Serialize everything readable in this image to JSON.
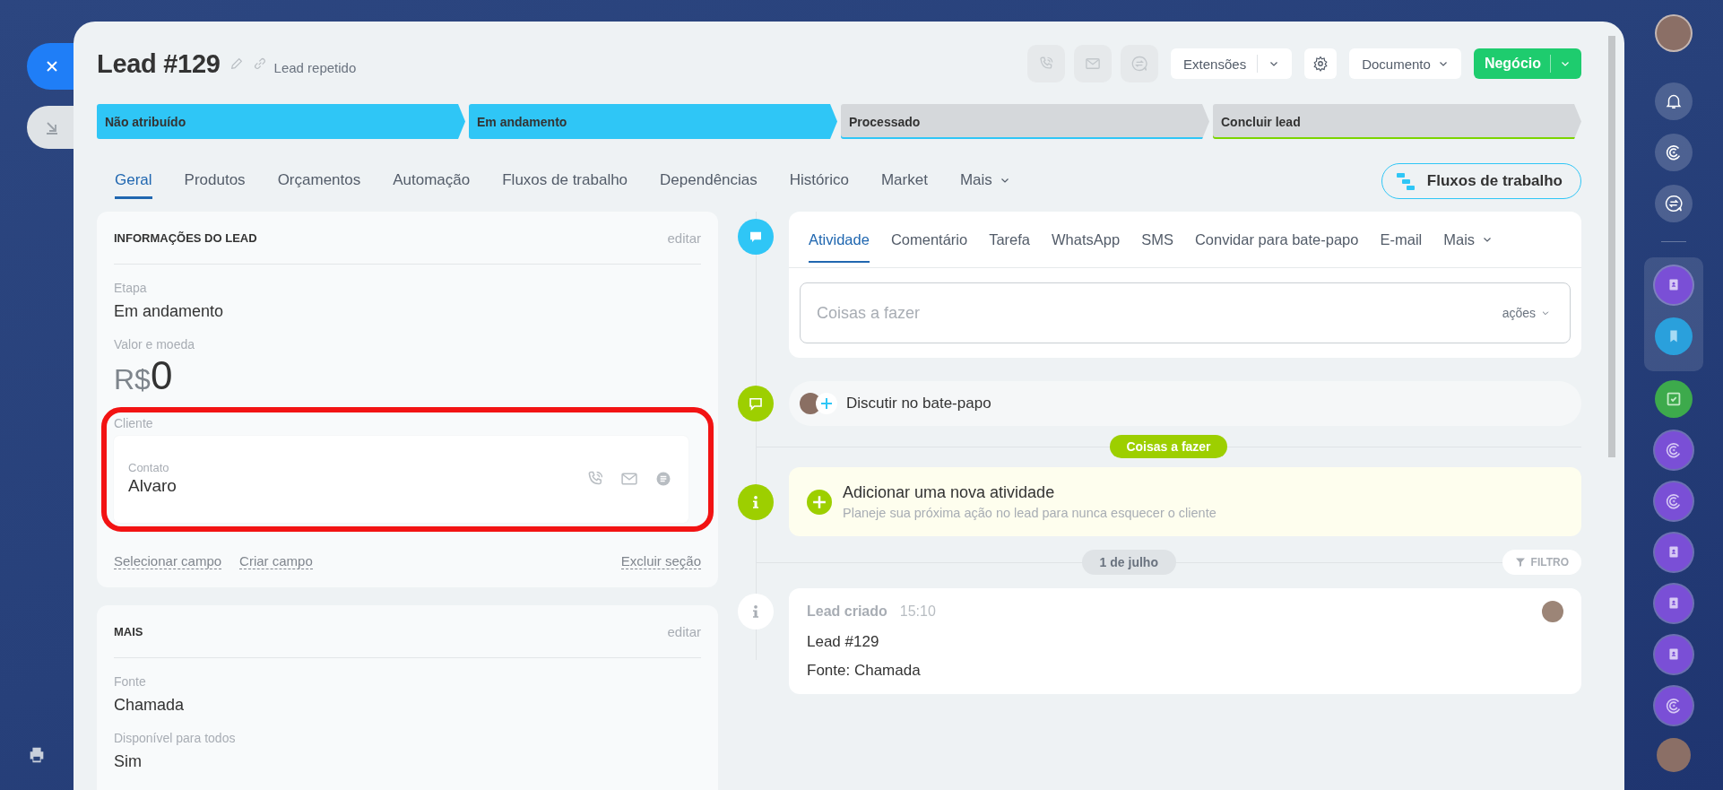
{
  "header": {
    "title": "Lead #129",
    "subtitle": "Lead repetido",
    "extensions_button": "Extensões",
    "document_button": "Documento",
    "primary_button": "Negócio"
  },
  "stages": [
    {
      "label": "Não atribuído",
      "reached": true,
      "color": "#2fc6f6"
    },
    {
      "label": "Em andamento",
      "reached": true,
      "color": "#2fc6f6"
    },
    {
      "label": "Processado",
      "reached": false,
      "color": "#2fc6f6"
    },
    {
      "label": "Concluir lead",
      "reached": false,
      "color": "#7bd500"
    }
  ],
  "tabs": [
    {
      "label": "Geral",
      "selected": true,
      "dropdown": false
    },
    {
      "label": "Produtos",
      "selected": false,
      "dropdown": false
    },
    {
      "label": "Orçamentos",
      "selected": false,
      "dropdown": false
    },
    {
      "label": "Automação",
      "selected": false,
      "dropdown": false
    },
    {
      "label": "Fluxos de trabalho",
      "selected": false,
      "dropdown": false
    },
    {
      "label": "Dependências",
      "selected": false,
      "dropdown": false
    },
    {
      "label": "Histórico",
      "selected": false,
      "dropdown": false
    },
    {
      "label": "Market",
      "selected": false,
      "dropdown": false
    },
    {
      "label": "Mais",
      "selected": false,
      "dropdown": true
    }
  ],
  "workflow_button": "Fluxos de trabalho",
  "lead_info": {
    "title": "INFORMAÇÕES DO LEAD",
    "edit": "editar",
    "fields": [
      {
        "label": "Etapa",
        "value": "Em andamento"
      }
    ],
    "amount": {
      "label": "Valor e moeda",
      "currency": "R$",
      "value": "0"
    },
    "client": {
      "label": "Cliente",
      "highlighted": true,
      "contact_label": "Contato",
      "contact_name": "Alvaro"
    },
    "links": [
      "Selecionar campo",
      "Criar campo"
    ],
    "delete_link": "Excluir seção"
  },
  "more": {
    "title": "MAIS",
    "edit": "editar",
    "fields": [
      {
        "label": "Fonte",
        "value": "Chamada"
      },
      {
        "label": "Disponível para todos",
        "value": "Sim"
      }
    ]
  },
  "activity": {
    "tabs": [
      {
        "label": "Atividade",
        "selected": true,
        "dropdown": false
      },
      {
        "label": "Comentário",
        "selected": false,
        "dropdown": false
      },
      {
        "label": "Tarefa",
        "selected": false,
        "dropdown": false
      },
      {
        "label": "WhatsApp",
        "selected": false,
        "dropdown": false
      },
      {
        "label": "SMS",
        "selected": false,
        "dropdown": false
      },
      {
        "label": "Convidar para bate-papo",
        "selected": false,
        "dropdown": false
      },
      {
        "label": "E-mail",
        "selected": false,
        "dropdown": false
      },
      {
        "label": "Mais",
        "selected": false,
        "dropdown": true
      }
    ],
    "placeholder": "Coisas a fazer",
    "actions": "ações"
  },
  "chat": {
    "label": "Discutir no bate-papo"
  },
  "todo_badge": "Coisas a fazer",
  "new_activity": {
    "title": "Adicionar uma nova atividade",
    "hint": "Planeje sua próxima ação no lead para nunca esquecer o cliente"
  },
  "date_badge": "1 de julho",
  "filter_button": "FILTRO",
  "event": {
    "title": "Lead criado",
    "time": "15:10",
    "lines": [
      "Lead #129",
      "Fonte: Chamada"
    ]
  }
}
